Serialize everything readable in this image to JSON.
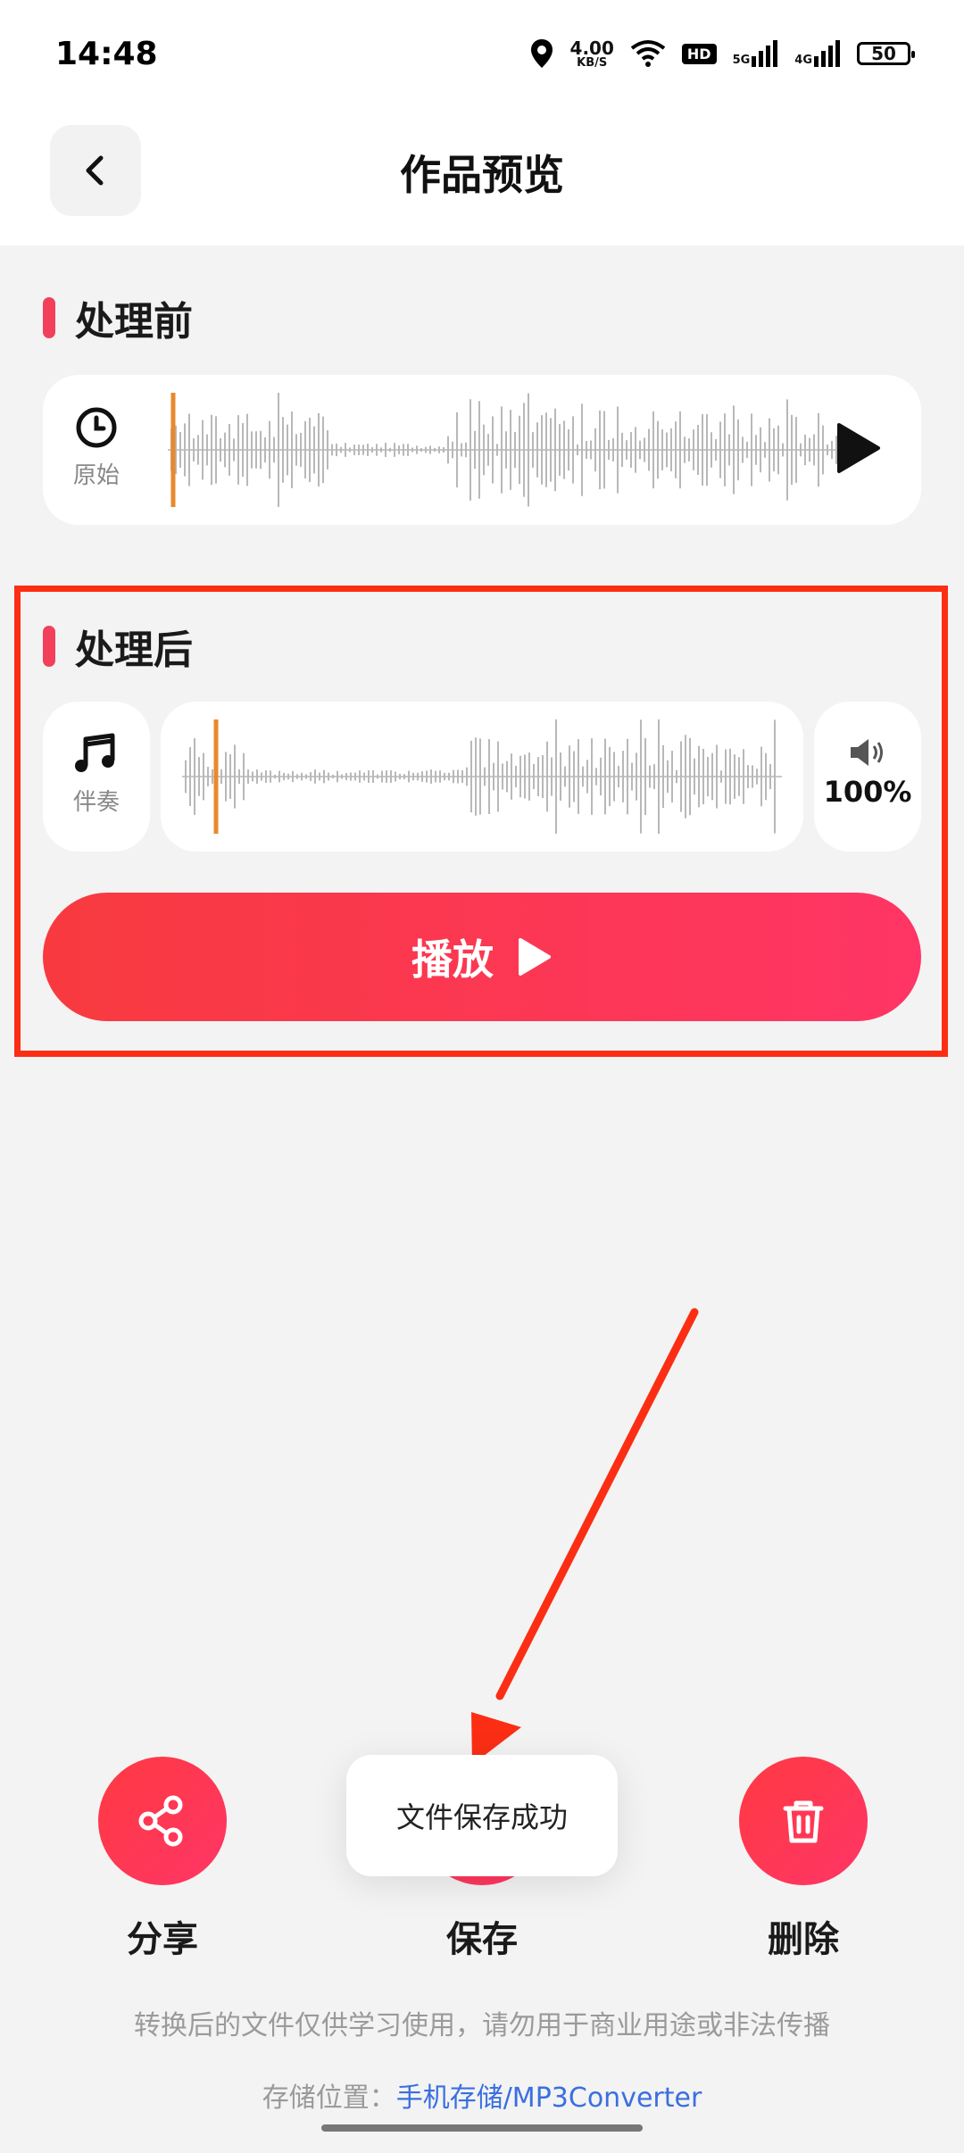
{
  "status_bar": {
    "time": "14:48",
    "net_speed_value": "4.00",
    "net_speed_unit": "KB/S",
    "hd_label": "HD",
    "signal_1_label": "5G",
    "signal_2_label": "4G",
    "battery": "50"
  },
  "header": {
    "title": "作品预览",
    "back_icon": "chevron-left-icon"
  },
  "before": {
    "section_title": "处理前",
    "track_label": "原始",
    "track_icon": "clock-icon",
    "play_icon": "play-icon",
    "playhead_color": "#e8892e"
  },
  "after": {
    "section_title": "处理后",
    "track_label": "伴奏",
    "track_icon": "music-note-icon",
    "volume_icon": "speaker-icon",
    "volume": "100%",
    "play_button_label": "播放",
    "playhead_color": "#e8892e"
  },
  "actions": {
    "share_label": "分享",
    "save_label": "保存",
    "delete_label": "删除"
  },
  "toast": "文件保存成功",
  "footer": {
    "disclaimer": "转换后的文件仅供学习使用，请勿用于商业用途或非法传播",
    "storage_prefix": "存储位置：",
    "storage_path_cn": "手机存储",
    "storage_path_rest": "/MP3Converter"
  },
  "colors": {
    "accent": "#f2405a",
    "annotation": "#fb2e14",
    "link": "#3a6fe0"
  }
}
